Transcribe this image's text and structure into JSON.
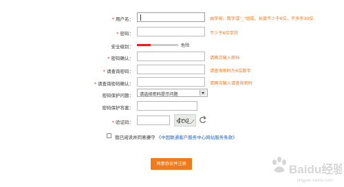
{
  "form": {
    "username": {
      "label": "用户名：",
      "value": "",
      "hint": "由字母，数字或\"_\"组成，长度不少于6位，不多于30位"
    },
    "password": {
      "label": "密码：",
      "value": "",
      "hint": "不少于6位字符"
    },
    "strength": {
      "label": "安全级别：",
      "level": 0.33,
      "text": "危险",
      "color": "#e02020"
    },
    "confirm_password": {
      "label": "密码确认：",
      "value": "",
      "hint": "请再次输入密码"
    },
    "query_password": {
      "label": "请查询密码：",
      "value": "",
      "hint": "请查询密码为6位数字"
    },
    "confirm_query_password": {
      "label": "请查询密码确认：",
      "value": "",
      "hint": "请再次输入请查询密码"
    },
    "security_question": {
      "label": "密码保护问题：",
      "selected": "请选择密码提示问题"
    },
    "security_answer": {
      "label": "密码保护答案：",
      "value": ""
    },
    "captcha": {
      "label": "验证码：",
      "value": "",
      "image_text": "4ca"
    },
    "agreement": {
      "text": "我已阅读并同意遵守",
      "link": "《中国联通客户服务中心网站服务条款》",
      "checked": false
    },
    "submit_label": "同意协议并注册"
  },
  "watermark": {
    "text": "Baidu经验",
    "url": "jingyan.baidu.com"
  },
  "colors": {
    "required_star": "#e03020",
    "hint": "#e8792a",
    "link": "#1e64c8",
    "submit": "#f07a1e"
  }
}
